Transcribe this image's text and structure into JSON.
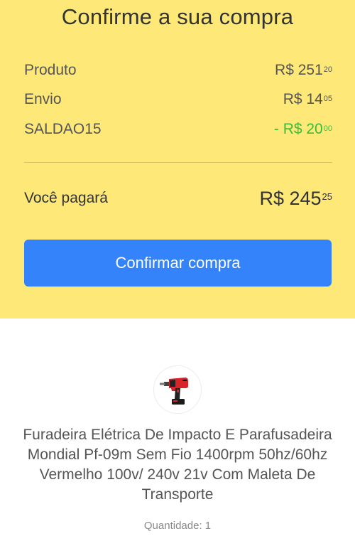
{
  "colors": {
    "summary_bg": "#fde878",
    "primary_button": "#3483fa",
    "discount_green": "#3dbb3a"
  },
  "summary": {
    "title": "Confirme a sua compra",
    "lines": [
      {
        "label": "Produto",
        "amount_main": "R$ 251",
        "amount_cents": "20"
      },
      {
        "label": "Envio",
        "amount_main": "R$ 14",
        "amount_cents": "05"
      },
      {
        "label": "SALDAO15",
        "amount_main": "- R$ 20",
        "amount_cents": "00"
      }
    ],
    "total": {
      "label": "Você pagará",
      "amount_main": "R$ 245",
      "amount_cents": "25"
    },
    "confirm_button_label": "Confirmar compra"
  },
  "product": {
    "image_icon": "drill-icon",
    "title": "Furadeira Elétrica De Impacto E Parafusadeira Mondial Pf-09m Sem Fio 1400rpm 50hz/60hz Vermelho 100v/ 240v 21v Com Maleta De Transporte",
    "quantity_text": "Quantidade: 1"
  }
}
